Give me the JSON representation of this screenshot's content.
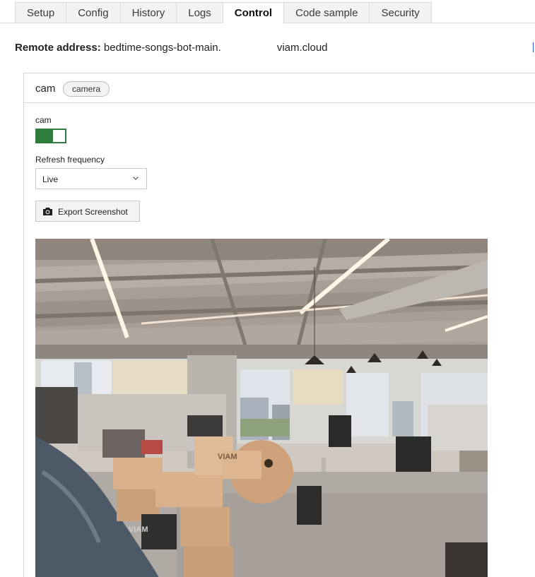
{
  "tabs": [
    {
      "label": "Setup"
    },
    {
      "label": "Config"
    },
    {
      "label": "History"
    },
    {
      "label": "Logs"
    },
    {
      "label": "Control",
      "active": true
    },
    {
      "label": "Code sample"
    },
    {
      "label": "Security"
    }
  ],
  "remote": {
    "label": "Remote address:",
    "host_prefix": "bedtime-songs-bot-main.",
    "host_suffix": "viam.cloud"
  },
  "camera_card": {
    "title": "cam",
    "badge": "camera",
    "stream_label": "cam",
    "stream_enabled": true,
    "refresh_label": "Refresh frequency",
    "refresh_value": "Live",
    "export_label": "Export Screenshot",
    "feed_text": "VIAM",
    "feed_text_2": "VIAM"
  },
  "colors": {
    "toggle_on": "#2e7d3f",
    "active_tab_bg": "#ffffff",
    "inactive_tab_bg": "#f2f2f2",
    "border": "#d6d6d6"
  },
  "icons": {
    "export": "camera-icon",
    "select": "chevron-down-icon"
  }
}
